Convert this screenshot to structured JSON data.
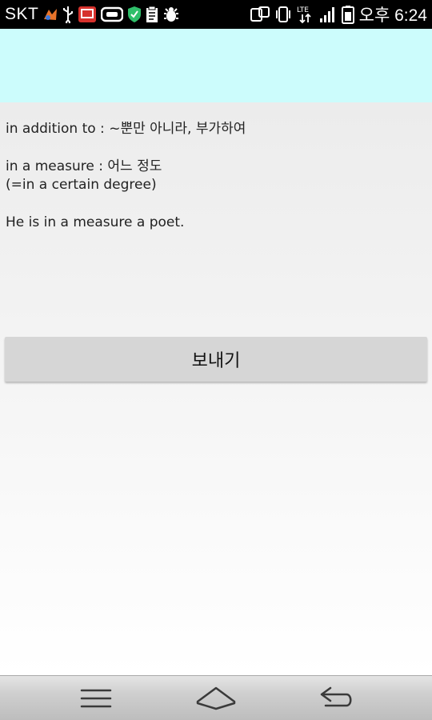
{
  "status_bar": {
    "carrier": "SKT",
    "clock": "오후 6:24",
    "network_label": "LTE",
    "left_icons": [
      "app-notification-icon",
      "usb-icon",
      "photo-app-icon",
      "link-icon",
      "shield-icon",
      "clipboard-icon",
      "debug-icon"
    ],
    "right_icons": [
      "screen-mirror-icon",
      "vibrate-icon",
      "lte-signal-icon",
      "signal-bars-icon",
      "battery-icon"
    ]
  },
  "header": {
    "background_color": "#ccfcfc"
  },
  "content": {
    "lines": [
      "in addition to : ~뿐만 아니라, 부가하여",
      "in a measure : 어느 정도",
      "(=in a certain degree)",
      "He is in a measure a poet."
    ],
    "send_button_label": "보내기"
  },
  "nav_bar": {
    "icons": [
      "menu-icon",
      "home-icon",
      "back-icon"
    ]
  }
}
